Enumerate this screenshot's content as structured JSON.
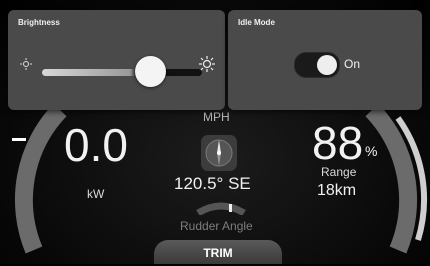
{
  "brightness": {
    "title": "Brightness",
    "level": 0.62
  },
  "idle_mode": {
    "title": "Idle Mode",
    "state": "On"
  },
  "dashboard": {
    "power_value": "0.0",
    "power_unit": "kW",
    "speed_unit": "MPH",
    "heading": "120.5° SE",
    "battery_value": "88",
    "battery_unit": "%",
    "range_label": "Range",
    "range_value": "18km",
    "rudder_label": "Rudder Angle"
  },
  "trim_label": "TRIM",
  "colors": {
    "popup_bg": "#4a4a4a",
    "background": "#000000"
  }
}
